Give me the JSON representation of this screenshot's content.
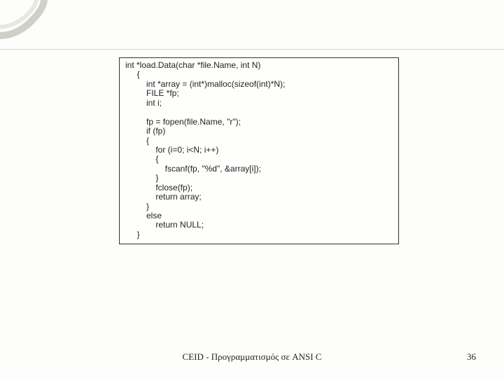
{
  "code": {
    "l01": "int *load.Data(char *file.Name, int N)",
    "l02": "     {",
    "l03": "         int *array = (int*)malloc(sizeof(int)*N);",
    "l04": "         FILE *fp;",
    "l05": "         int i;",
    "l06": "",
    "l07": "         fp = fopen(file.Name, \"r\");",
    "l08": "         if (fp)",
    "l09": "         {",
    "l10": "             for (i=0; i<N; i++)",
    "l11": "             {",
    "l12": "                 fscanf(fp, \"%d\", &array[i]);",
    "l13": "             }",
    "l14": "             fclose(fp);",
    "l15": "             return array;",
    "l16": "         }",
    "l17": "         else",
    "l18": "             return NULL;",
    "l19": "     }"
  },
  "footer": {
    "center": "CEID - Προγραμματισμός σε ANSI C",
    "pageNumber": "36"
  },
  "deco": {
    "stroke": "#d0d0c8"
  }
}
